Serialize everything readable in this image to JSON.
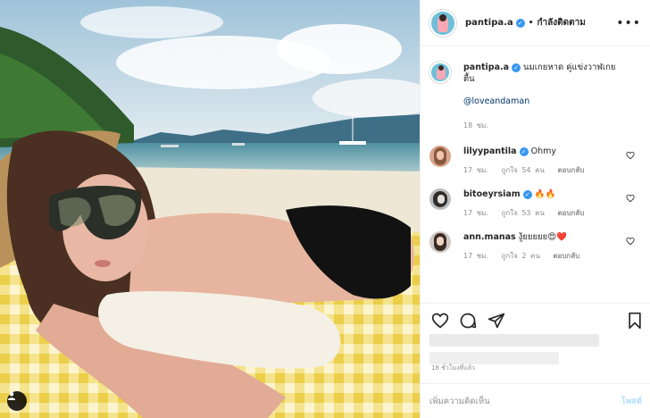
{
  "post": {
    "username": "pantipa.a",
    "follow_status": "กำลังติดตาม",
    "more_icon": "more-options-icon",
    "caption_text": "นมเกยหาด คู่แข่งวาฬเกยตื้น",
    "caption_mention": "@loveandaman",
    "caption_time": "18 ชม."
  },
  "comments": [
    {
      "user": "lilyypantila",
      "text": "Ohmy",
      "time": "17 ชม.",
      "likes": "ถูกใจ 54 คน",
      "reply": "ตอบกลับ"
    },
    {
      "user": "bitoeyrsiam",
      "text": "🔥🔥",
      "time": "17 ชม.",
      "likes": "ถูกใจ 53 คน",
      "reply": "ตอบกลับ"
    },
    {
      "user": "ann.manas",
      "text": "งู้ยยยยย😍❤️",
      "time": "17 ชม.",
      "likes": "ถูกใจ 2 คน",
      "reply": "ตอบกลับ"
    }
  ],
  "actions": {
    "like_icon": "heart-icon",
    "comment_icon": "comment-icon",
    "share_icon": "share-icon",
    "save_icon": "bookmark-icon"
  },
  "post_time": "18 ชั่วโมงที่แล้ว",
  "add_comment": {
    "placeholder": "เพิ่มความคิดเห็น",
    "post_label": "โพสต์"
  },
  "colors": {
    "verified": "#3897f0",
    "meta": "#8e8e8e",
    "post_disabled": "#b2dffc"
  }
}
